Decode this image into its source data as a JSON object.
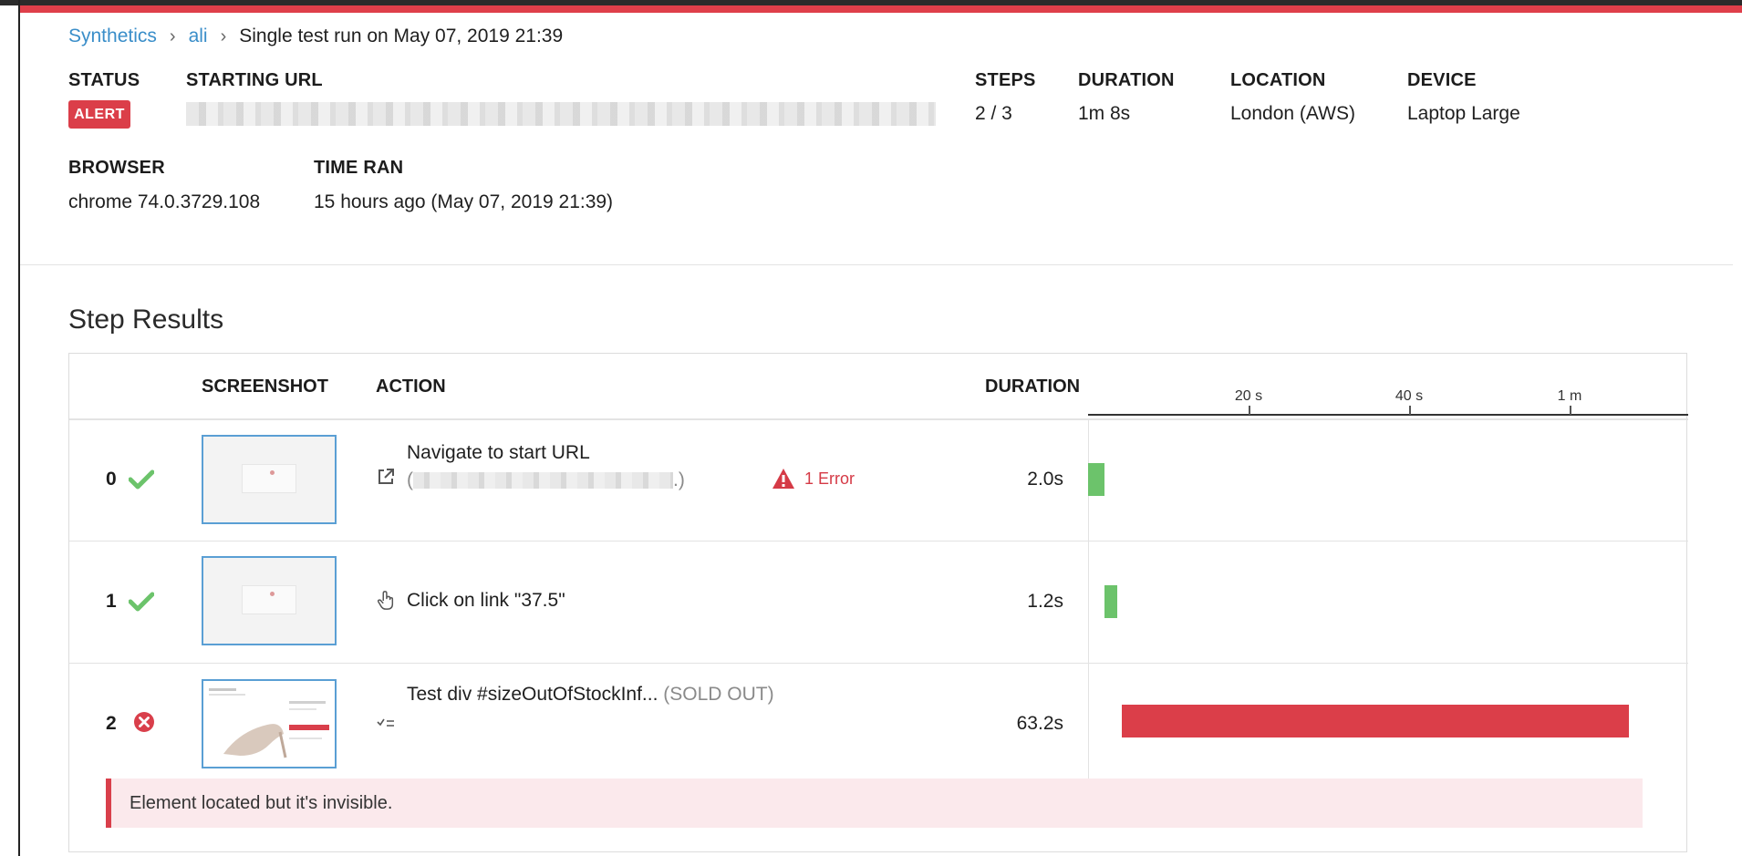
{
  "breadcrumb": {
    "items": [
      "Synthetics",
      "ali"
    ],
    "current": "Single test run on May 07, 2019 21:39"
  },
  "summary": {
    "status_label": "STATUS",
    "status_value": "ALERT",
    "starting_url_label": "STARTING URL",
    "steps_label": "STEPS",
    "steps_value": "2 / 3",
    "duration_label": "DURATION",
    "duration_value": "1m 8s",
    "location_label": "LOCATION",
    "location_value": "London (AWS)",
    "device_label": "DEVICE",
    "device_value": "Laptop Large",
    "browser_label": "BROWSER",
    "browser_value": "chrome 74.0.3729.108",
    "time_ran_label": "TIME RAN",
    "time_ran_value": "15 hours ago (May 07, 2019 21:39)"
  },
  "step_results": {
    "title": "Step Results",
    "columns": {
      "screenshot": "SCREENSHOT",
      "action": "ACTION",
      "duration": "DURATION"
    },
    "timeline_ticks": [
      "20 s",
      "40 s",
      "1 m"
    ],
    "timeline_max_seconds": 70,
    "steps": [
      {
        "index": "0",
        "status": "passed",
        "action_icon": "external-link-icon",
        "action": "Navigate to start URL",
        "action_detail_open": "(",
        "action_detail_close": ".)",
        "error_badge": "1 Error",
        "duration": "2.0s",
        "start_s": 0,
        "duration_s": 2.0
      },
      {
        "index": "1",
        "status": "passed",
        "action_icon": "pointer-hand-icon",
        "action": "Click on link \"37.5\"",
        "duration": "1.2s",
        "start_s": 2.0,
        "duration_s": 1.2
      },
      {
        "index": "2",
        "status": "failed",
        "action_icon": "assertion-icon",
        "action": "Test div #sizeOutOfStockInf...",
        "action_detail": "(SOLD OUT)",
        "duration": "63.2s",
        "start_s": 4.2,
        "duration_s": 63.2,
        "error_message": "Element located but it's invisible."
      }
    ]
  },
  "colors": {
    "accent_link": "#3a8ec9",
    "alert_red": "#db3e49",
    "success_green": "#6cc36b",
    "error_bg": "#fbe9ec"
  }
}
